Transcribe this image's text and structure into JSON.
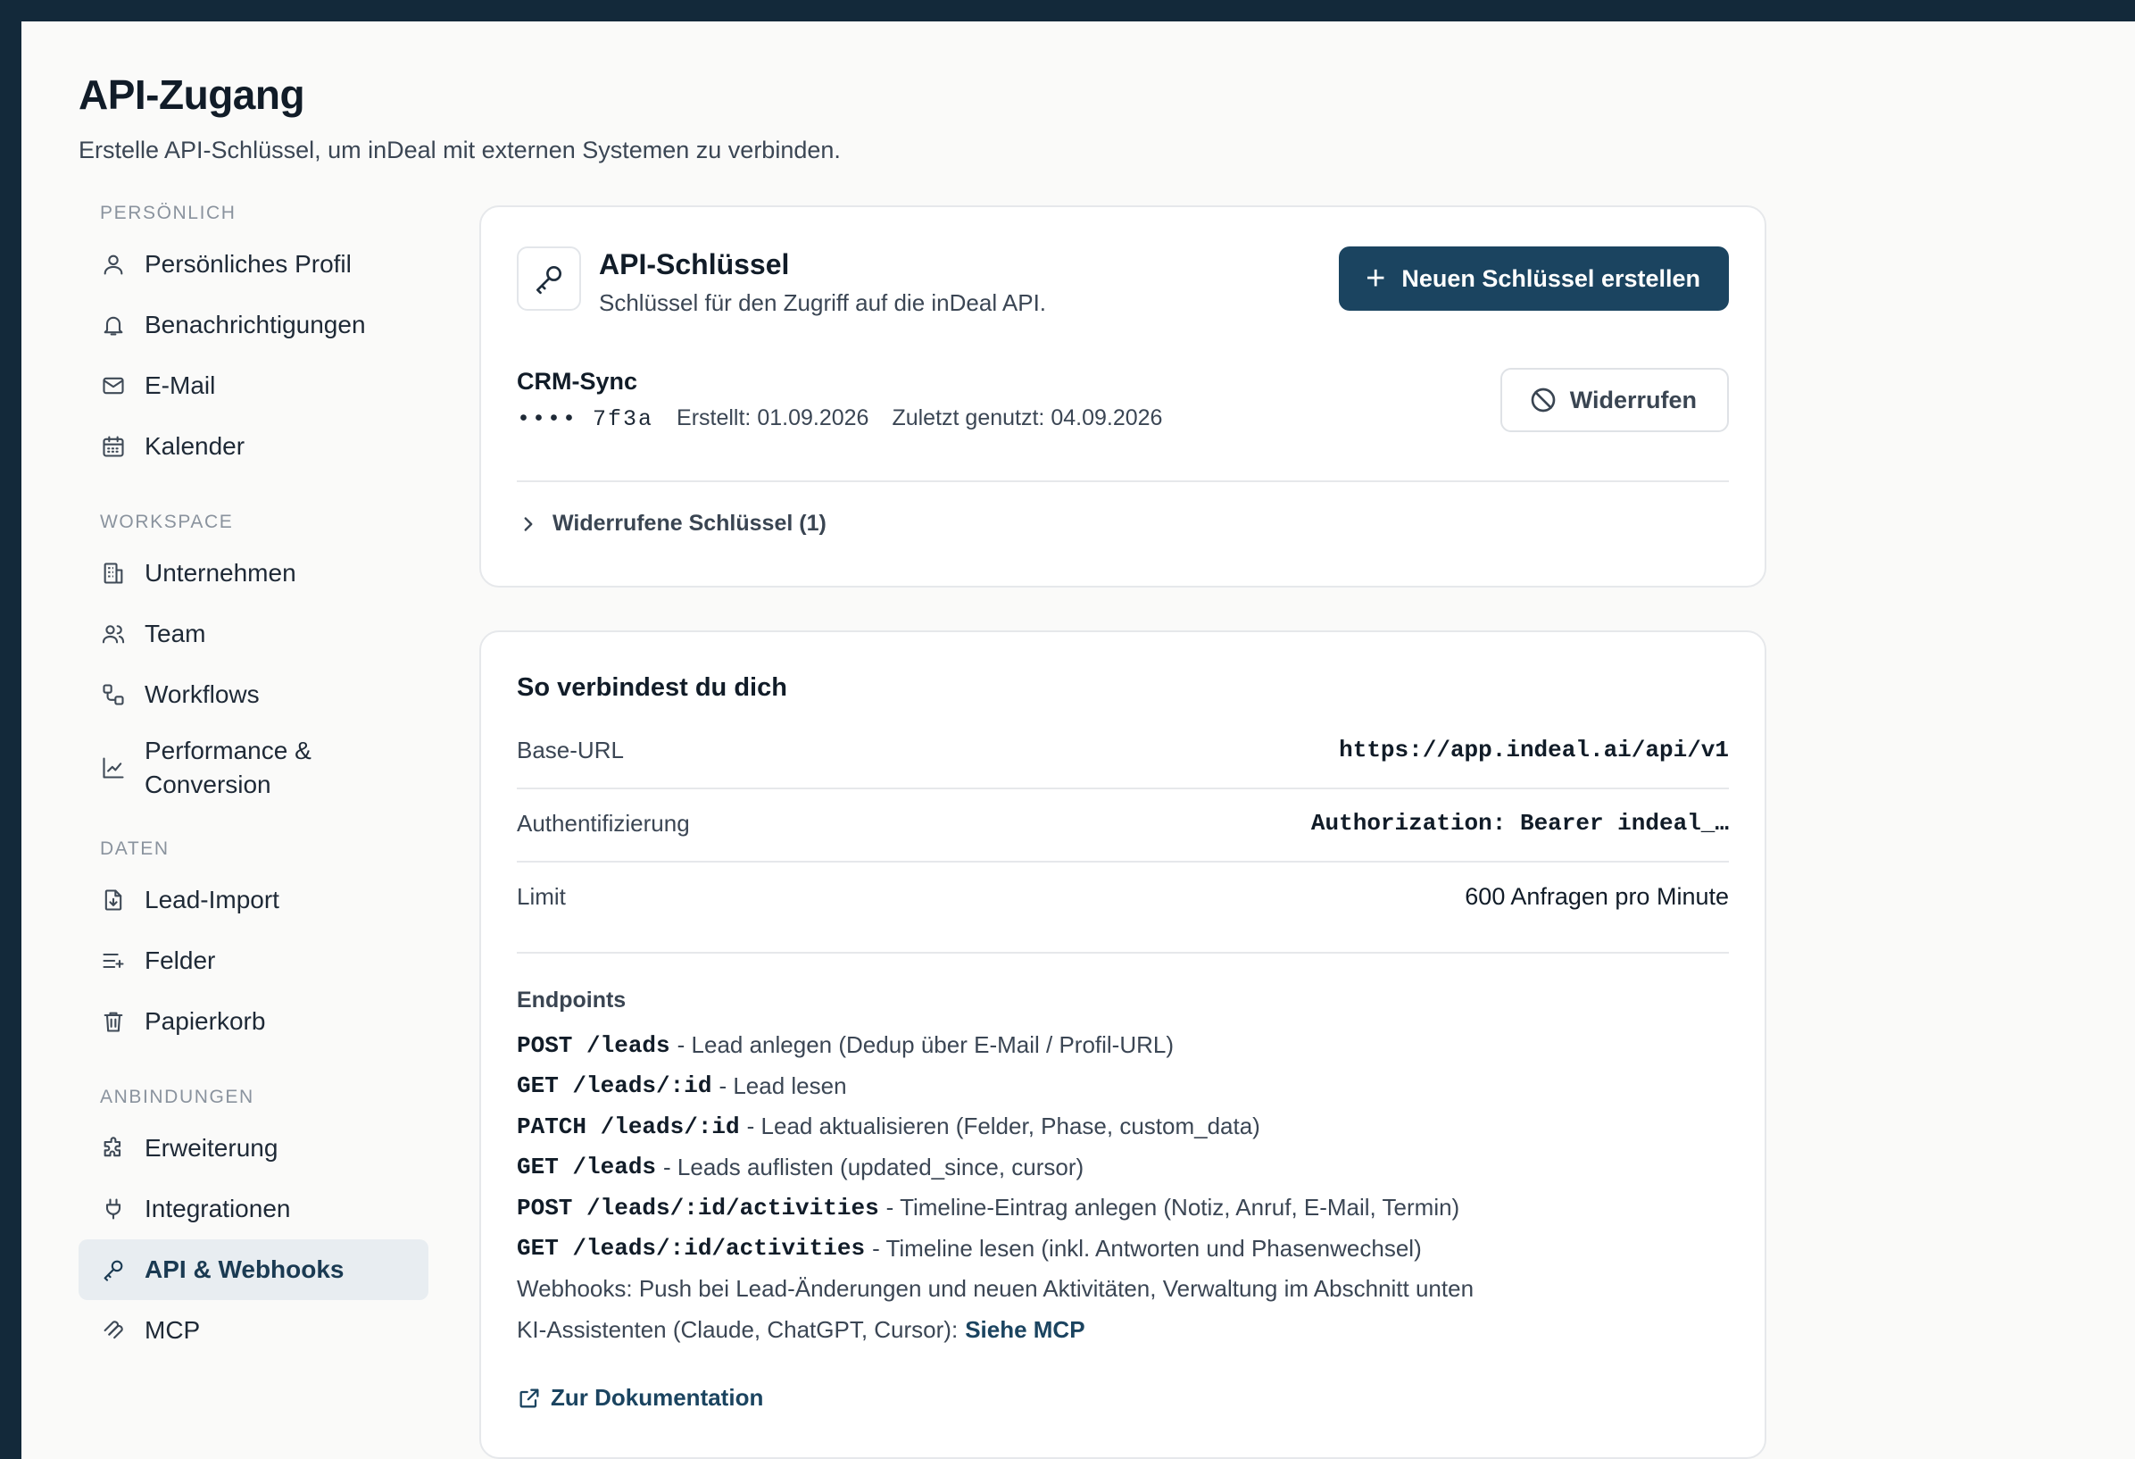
{
  "page": {
    "title": "API-Zugang",
    "subtitle": "Erstelle API-Schlüssel, um inDeal mit externen Systemen zu verbinden."
  },
  "sidebar": {
    "sections": [
      {
        "title": "PERSÖNLICH",
        "items": [
          {
            "label": "Persönliches Profil",
            "icon": "user-icon"
          },
          {
            "label": "Benachrichtigungen",
            "icon": "bell-icon"
          },
          {
            "label": "E-Mail",
            "icon": "mail-icon"
          },
          {
            "label": "Kalender",
            "icon": "calendar-icon"
          }
        ]
      },
      {
        "title": "WORKSPACE",
        "items": [
          {
            "label": "Unternehmen",
            "icon": "building-icon"
          },
          {
            "label": "Team",
            "icon": "users-icon"
          },
          {
            "label": "Workflows",
            "icon": "workflow-icon"
          },
          {
            "label": "Performance & Conversion",
            "icon": "chart-line-icon"
          }
        ]
      },
      {
        "title": "DATEN",
        "items": [
          {
            "label": "Lead-Import",
            "icon": "file-import-icon"
          },
          {
            "label": "Felder",
            "icon": "list-plus-icon"
          },
          {
            "label": "Papierkorb",
            "icon": "trash-icon"
          }
        ]
      },
      {
        "title": "ANBINDUNGEN",
        "items": [
          {
            "label": "Erweiterung",
            "icon": "puzzle-icon"
          },
          {
            "label": "Integrationen",
            "icon": "plug-icon"
          },
          {
            "label": "API & Webhooks",
            "icon": "key-icon",
            "active": true
          },
          {
            "label": "MCP",
            "icon": "mcp-icon"
          }
        ]
      }
    ]
  },
  "api_keys_card": {
    "title": "API-Schlüssel",
    "description": "Schlüssel für den Zugriff auf die inDeal API.",
    "create_button": "Neuen Schlüssel erstellen",
    "key": {
      "name": "CRM-Sync",
      "masked": "•••• 7f3a",
      "created": "Erstellt: 01.09.2026",
      "last_used": "Zuletzt genutzt: 04.09.2026",
      "revoke_button": "Widerrufen"
    },
    "revoked_toggle": "Widerrufene Schlüssel (1)"
  },
  "connect_card": {
    "title": "So verbindest du dich",
    "rows": [
      {
        "key": "Base-URL",
        "value": "https://app.indeal.ai/api/v1"
      },
      {
        "key": "Authentifizierung",
        "value": "Authorization: Bearer indeal_…"
      },
      {
        "key": "Limit",
        "value": "600 Anfragen pro Minute"
      }
    ],
    "endpoints_title": "Endpoints",
    "endpoints": [
      {
        "code": "POST /leads",
        "text": "- Lead anlegen (Dedup über E-Mail / Profil-URL)"
      },
      {
        "code": "GET /leads/:id",
        "text": "- Lead lesen"
      },
      {
        "code": "PATCH /leads/:id",
        "text": "- Lead aktualisieren (Felder, Phase, custom_data)"
      },
      {
        "code": "GET /leads",
        "text": "- Leads auflisten (updated_since, cursor)"
      },
      {
        "code": "POST /leads/:id/activities",
        "text": "- Timeline-Eintrag anlegen (Notiz, Anruf, E-Mail, Termin)"
      },
      {
        "code": "GET /leads/:id/activities",
        "text": "- Timeline lesen (inkl. Antworten und Phasenwechsel)"
      }
    ],
    "webhooks_note": "Webhooks: Push bei Lead-Änderungen und neuen Aktivitäten, Verwaltung im Abschnitt unten",
    "ai_note": "KI-Assistenten (Claude, ChatGPT, Cursor):",
    "ai_link": "Siehe MCP",
    "doc_link": "Zur Dokumentation"
  }
}
